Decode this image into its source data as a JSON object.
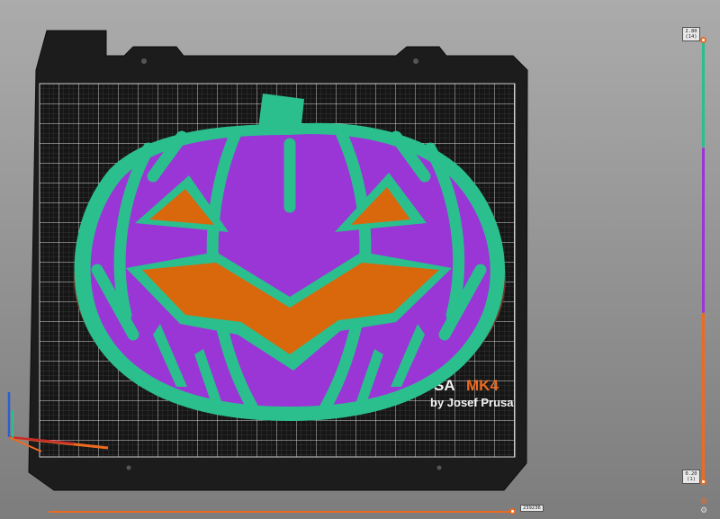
{
  "bed": {
    "brand_prefix": "SA",
    "brand_model": "MK4",
    "brand_byline": "by Josef Prusa"
  },
  "layers": {
    "top_label_height": "2.80",
    "top_label_index": "(14)",
    "bottom_label_height": "0.20",
    "bottom_label_index": "(1)"
  },
  "moves": {
    "current": "239236"
  },
  "icons": {
    "cog": "cog-icon",
    "settings": "settings-icon"
  },
  "colors": {
    "accent": "#ed6b21",
    "pumpkin_body": "#9a35d6",
    "pumpkin_outline": "#2bbf8e",
    "pumpkin_face": "#d9680c",
    "bed_sheet": "#151515"
  }
}
